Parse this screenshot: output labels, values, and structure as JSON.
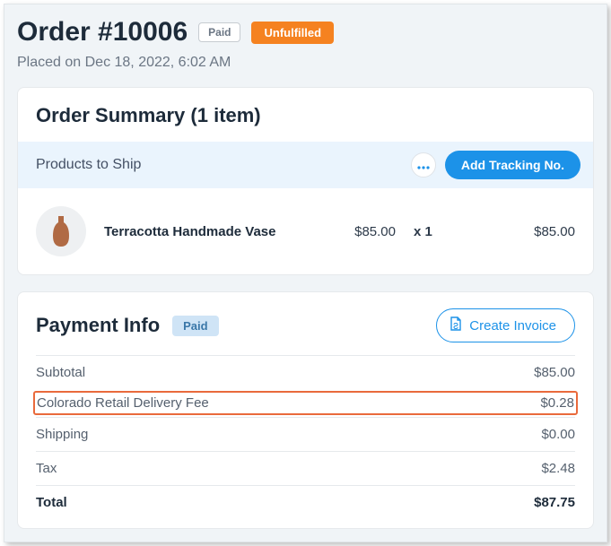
{
  "header": {
    "title": "Order #10006",
    "paid_badge": "Paid",
    "unfulfilled_badge": "Unfulfilled",
    "placed": "Placed on Dec 18, 2022, 6:02 AM"
  },
  "summary": {
    "title": "Order Summary (1 item)",
    "ship_header": "Products to Ship",
    "add_tracking": "Add Tracking No.",
    "item": {
      "name": "Terracotta Handmade Vase",
      "price": "$85.00",
      "qty": "x 1",
      "total": "$85.00"
    }
  },
  "payment": {
    "title": "Payment Info",
    "paid_badge": "Paid",
    "create_invoice": "Create Invoice",
    "rows": {
      "subtotal_label": "Subtotal",
      "subtotal_value": "$85.00",
      "fee_label": "Colorado Retail Delivery Fee",
      "fee_value": "$0.28",
      "shipping_label": "Shipping",
      "shipping_value": "$0.00",
      "tax_label": "Tax",
      "tax_value": "$2.48",
      "total_label": "Total",
      "total_value": "$87.75"
    }
  }
}
